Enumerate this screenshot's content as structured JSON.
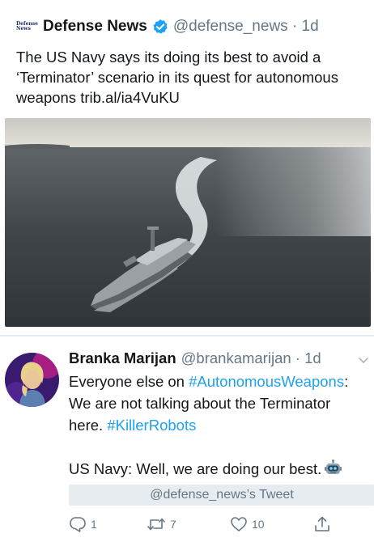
{
  "quoted_tweet": {
    "account_name": "Defense News",
    "logo_text": [
      "Defense",
      "News"
    ],
    "handle_time": "@defense_news · 1d",
    "text": "The US Navy says its doing its best to avoid a ‘Terminator’ scenario in its quest for autonomous weapons trib.al/ia4VuKU",
    "verified": true,
    "media_icon": "navy-drone-ship-photo"
  },
  "tweet": {
    "author_name": "Branka Marijan",
    "handle_time": "@brankamarijan · 1d",
    "body": {
      "line1_prefix": "Everyone else on ",
      "line1_hashtag": "#AutonomousWeapons",
      "line1_suffix": ":",
      "line2": "We are not talking about the Terminator",
      "line3_prefix": "here. ",
      "line3_hashtag": "#KillerRobots",
      "line4": "US Navy: Well, we are doing our best."
    },
    "quoted_label": "@defense_news’s Tweet",
    "actions": {
      "reply_count": "1",
      "retweet_count": "7",
      "like_count": "10"
    }
  },
  "colors": {
    "link": "#1da1f2",
    "secondary_text": "#657786",
    "divider": "#e6ecf0",
    "verified": "#1da1f2"
  }
}
